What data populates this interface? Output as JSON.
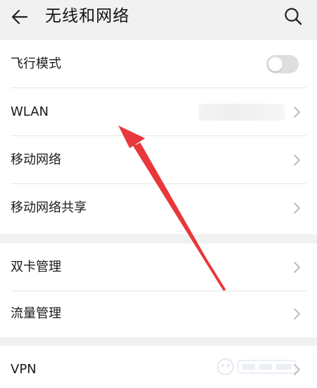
{
  "header": {
    "title": "无线和网络",
    "back_icon": "arrow-left-icon",
    "search_icon": "search-icon"
  },
  "sections": [
    {
      "items": [
        {
          "label": "飞行模式",
          "control": "toggle",
          "toggle_on": false
        },
        {
          "label": "WLAN",
          "control": "chevron",
          "value_hidden": true
        },
        {
          "label": "移动网络",
          "control": "chevron"
        },
        {
          "label": "移动网络共享",
          "control": "chevron"
        }
      ]
    },
    {
      "items": [
        {
          "label": "双卡管理",
          "control": "chevron"
        },
        {
          "label": "流量管理",
          "control": "chevron"
        }
      ]
    },
    {
      "items": [
        {
          "label": "VPN",
          "control": "chevron"
        }
      ]
    }
  ],
  "annotation": {
    "icon": "red-arrow-icon",
    "color": "#e8383b"
  },
  "colors": {
    "background": "#f1f1f1",
    "card": "#ffffff",
    "text": "#1a1a1a",
    "toggle_off": "#dedede",
    "chevron": "#b5b5b5"
  }
}
